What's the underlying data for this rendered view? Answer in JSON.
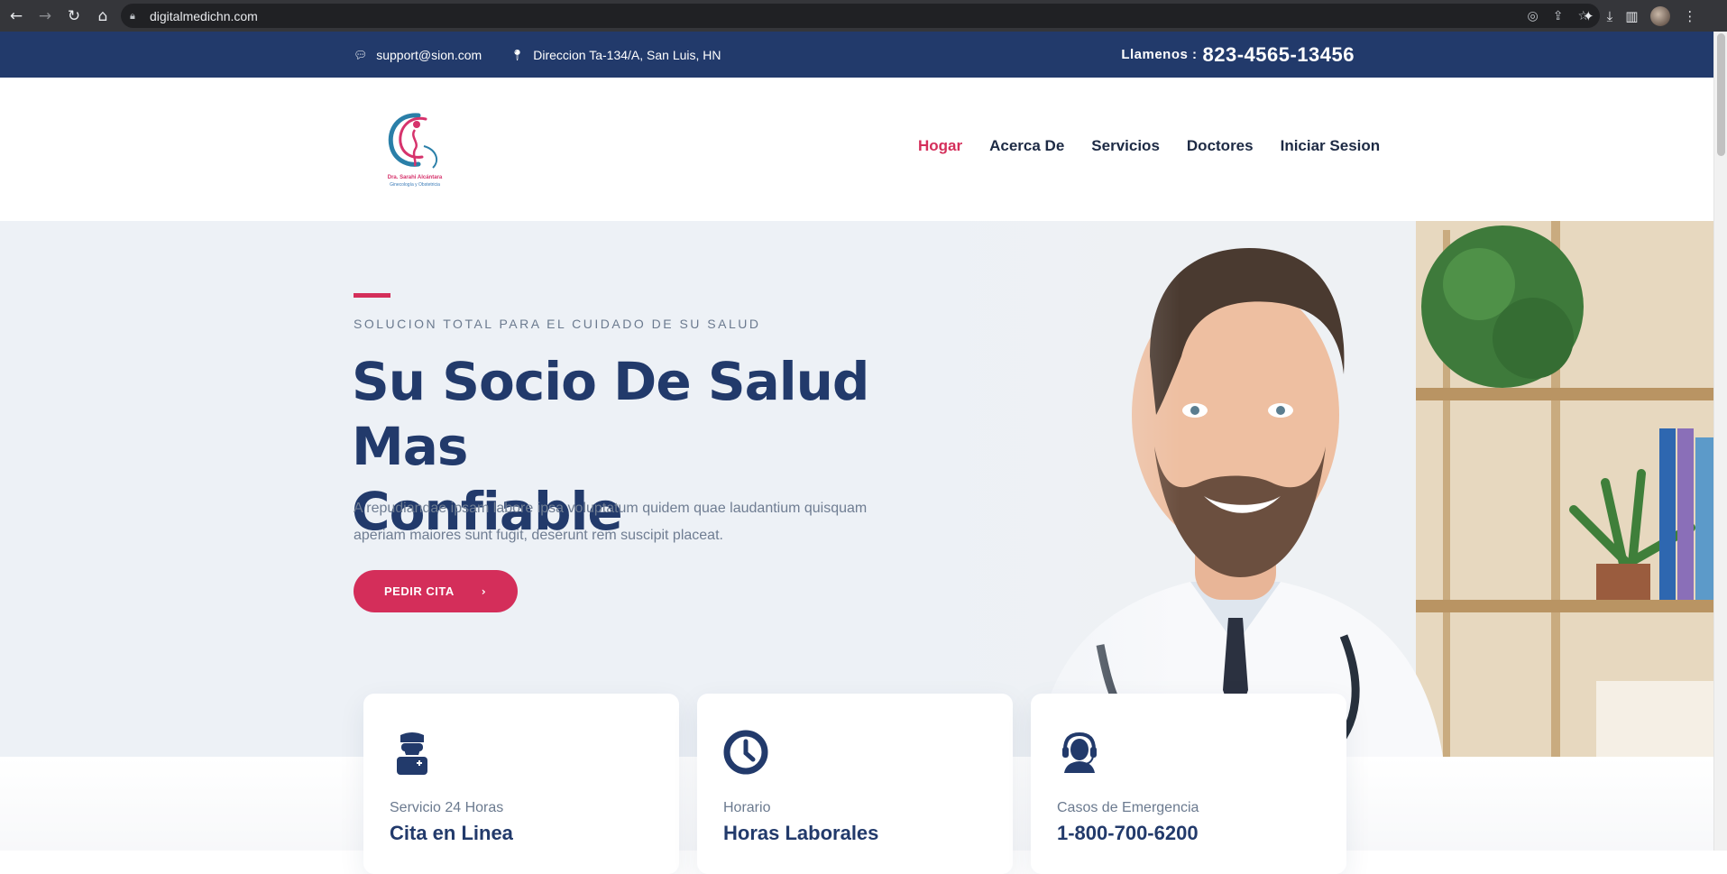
{
  "browser": {
    "url": "digitalmedichn.com",
    "icons": [
      "back-icon",
      "forward-icon",
      "reload-icon",
      "home-icon",
      "lock-icon",
      "lens-icon",
      "share-icon",
      "star-icon",
      "extensions-icon",
      "download-icon",
      "sidepanel-icon",
      "profile-avatar",
      "menu-icon"
    ]
  },
  "topbar": {
    "email": "support@sion.com",
    "address": "Direccion Ta-134/A, San Luis, HN",
    "call_label": "Llamenos :",
    "phone": "823-4565-13456"
  },
  "header": {
    "logo_line1": "Dra. Sarahi Alcántara",
    "logo_line2": "Ginecología y Obstetricia",
    "nav": [
      {
        "label": "Hogar",
        "active": true
      },
      {
        "label": "Acerca De",
        "active": false
      },
      {
        "label": "Servicios",
        "active": false
      },
      {
        "label": "Doctores",
        "active": false
      },
      {
        "label": "Iniciar Sesion",
        "active": false
      }
    ]
  },
  "hero": {
    "kicker": "SOLUCION TOTAL PARA EL CUIDADO DE SU SALUD",
    "headline_line1": "Su Socio De Salud Mas",
    "headline_line2": "Confiable",
    "lead": "A repudiandae ipsam labore ipsa voluptatum quidem quae laudantium quisquam aperiam maiores sunt fugit, deserunt rem suscipit placeat.",
    "cta": "PEDIR CITA",
    "cta_icon": "chevron-right-icon"
  },
  "cards": [
    {
      "icon": "doctor-icon",
      "subtitle": "Servicio 24 Horas",
      "title": "Cita en Linea"
    },
    {
      "icon": "clock-icon",
      "subtitle": "Horario",
      "title": "Horas Laborales"
    },
    {
      "icon": "headset-icon",
      "subtitle": "Casos de Emergencia",
      "title": "1-800-700-6200"
    }
  ],
  "colors": {
    "brand_navy": "#223a6b",
    "accent_pink": "#d42e5a",
    "hero_bg": "#edf1f6"
  }
}
